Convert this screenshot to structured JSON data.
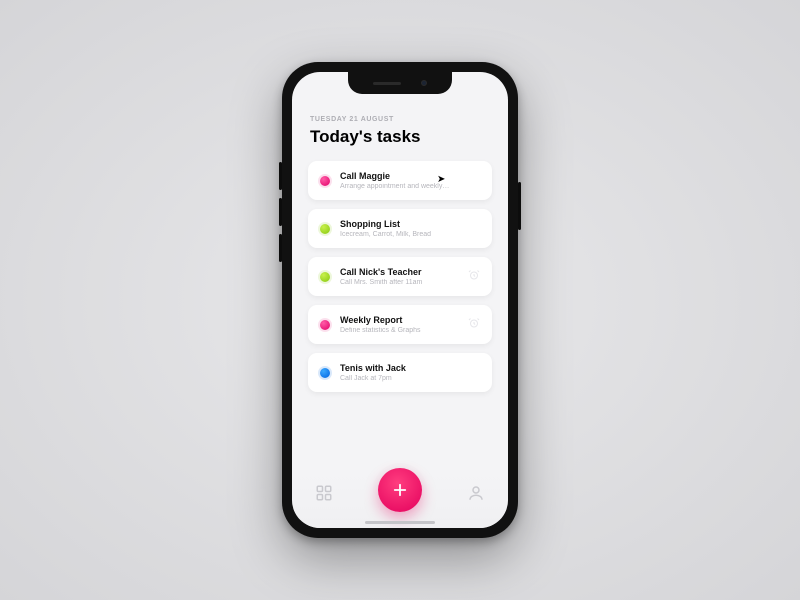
{
  "header": {
    "date": "TUESDAY 21 AUGUST",
    "title": "Today's tasks"
  },
  "tasks": [
    {
      "title": "Call Maggie",
      "subtitle": "Arrange appointment and weekly…",
      "color": "pink",
      "alarm": false
    },
    {
      "title": "Shopping List",
      "subtitle": "Icecream, Carrot, Milk, Bread",
      "color": "green",
      "alarm": false
    },
    {
      "title": "Call Nick's Teacher",
      "subtitle": "Call Mrs. Smith after 11am",
      "color": "green",
      "alarm": true
    },
    {
      "title": "Weekly Report",
      "subtitle": "Define statistics & Graphs",
      "color": "pink",
      "alarm": true
    },
    {
      "title": "Tenis with Jack",
      "subtitle": "Call Jack at 7pm",
      "color": "blue",
      "alarm": false
    }
  ],
  "nav": {
    "add_label": "+"
  }
}
